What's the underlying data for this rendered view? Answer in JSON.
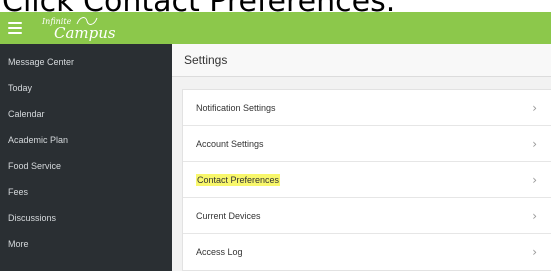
{
  "caption": "Click Contact Preferences.",
  "brand": {
    "logo_top": "Infinite",
    "logo_bottom": "Campus"
  },
  "colors": {
    "topbar": "#8cc84b",
    "sidebar": "#2a2f33",
    "highlight": "#f8f76b"
  },
  "sidebar": {
    "items": [
      {
        "label": "Message Center"
      },
      {
        "label": "Today"
      },
      {
        "label": "Calendar"
      },
      {
        "label": "Academic Plan"
      },
      {
        "label": "Food Service"
      },
      {
        "label": "Fees"
      },
      {
        "label": "Discussions"
      },
      {
        "label": "More"
      }
    ]
  },
  "main": {
    "title": "Settings",
    "rows": [
      {
        "label": "Notification Settings",
        "icon": "chevron-right-icon"
      },
      {
        "label": "Account Settings",
        "icon": "chevron-right-icon"
      },
      {
        "label": "Contact Preferences",
        "icon": "chevron-right-icon",
        "highlighted": true
      },
      {
        "label": "Current Devices",
        "icon": "chevron-right-icon"
      },
      {
        "label": "Access Log",
        "icon": "chevron-right-icon"
      }
    ]
  }
}
